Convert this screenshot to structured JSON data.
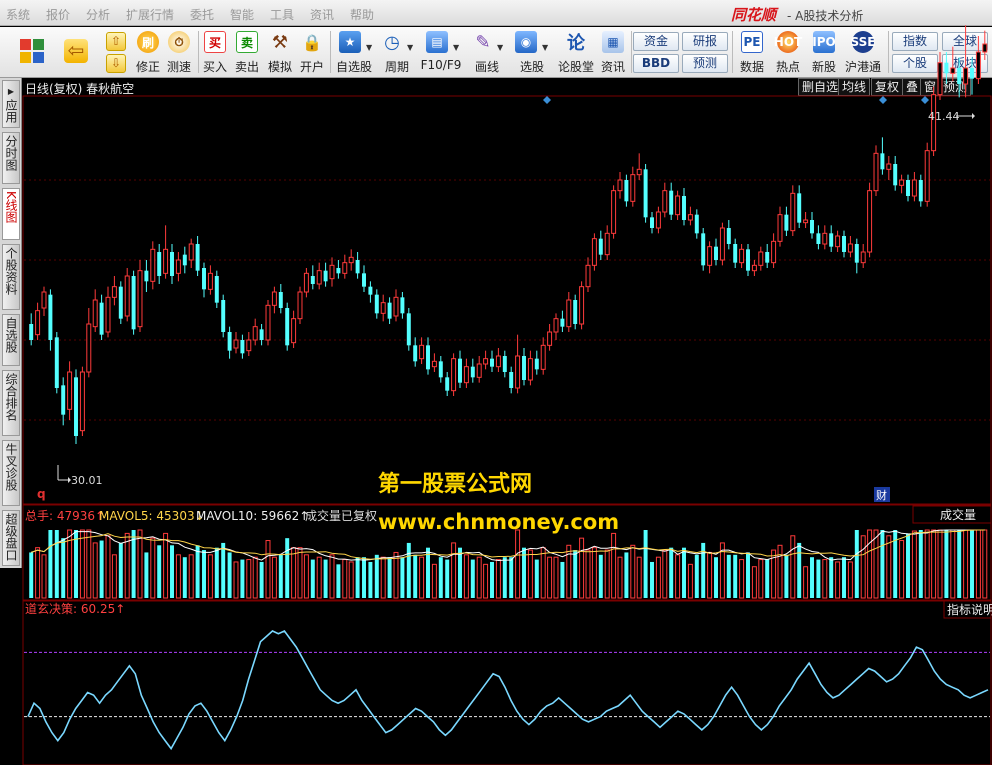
{
  "menu": [
    "系统",
    "报价",
    "分析",
    "扩展行情",
    "委托",
    "智能",
    "工具",
    "资讯",
    "帮助"
  ],
  "app": {
    "logo": "同花顺",
    "title": "- A股技术分析"
  },
  "toolbar": {
    "buttons": [
      {
        "label": "修正",
        "icon": "刷"
      },
      {
        "label": "测速",
        "icon": "⏱"
      },
      {
        "label": "买入",
        "icon": "买"
      },
      {
        "label": "卖出",
        "icon": "卖"
      },
      {
        "label": "模拟",
        "icon": "⚒"
      },
      {
        "label": "开户",
        "icon": "🔒"
      },
      {
        "label": "自选股",
        "icon": "★"
      },
      {
        "label": "周期",
        "icon": "◷"
      },
      {
        "label": "F10/F9",
        "icon": "▤"
      },
      {
        "label": "画线",
        "icon": "✎"
      },
      {
        "label": "选股",
        "icon": "◉"
      },
      {
        "label": "论股堂",
        "icon": "论"
      },
      {
        "label": "资讯",
        "icon": "▦"
      },
      {
        "label": "数据",
        "icon": "PE"
      },
      {
        "label": "热点",
        "icon": "HOT"
      },
      {
        "label": "新股",
        "icon": "IPO"
      },
      {
        "label": "沪港通",
        "icon": "SSE"
      }
    ],
    "boxes": [
      "资金",
      "BBD",
      "研报",
      "预测",
      "指数",
      "个股",
      "全球",
      "板块"
    ]
  },
  "sidetabs": [
    {
      "label": "应用",
      "active": false
    },
    {
      "label": "分时图",
      "active": false
    },
    {
      "label": "K线图",
      "active": true
    },
    {
      "label": "个股资料",
      "active": false
    },
    {
      "label": "自选股",
      "active": false
    },
    {
      "label": "综合排名",
      "active": false
    },
    {
      "label": "牛叉诊股",
      "active": false
    },
    {
      "label": "超级盘口",
      "active": false
    }
  ],
  "chart_header": {
    "title": "日线(复权) 春秋航空",
    "buttons": [
      "删自选",
      "均线",
      "复权",
      "叠",
      "窗",
      "预测"
    ]
  },
  "chart_data": {
    "type": "candlestick",
    "price_range": [
      28,
      43
    ],
    "high_label": "41.44",
    "low_label": "30.01",
    "candles": [
      [
        34.6,
        34.0,
        35.0,
        33.8
      ],
      [
        34.2,
        35.1,
        35.4,
        34.0
      ],
      [
        35.2,
        35.8,
        36.0,
        34.9
      ],
      [
        35.7,
        34.0,
        35.9,
        33.6
      ],
      [
        34.1,
        32.2,
        34.3,
        32.0
      ],
      [
        32.3,
        31.2,
        32.6,
        30.8
      ],
      [
        31.4,
        32.8,
        33.2,
        31.0
      ],
      [
        32.6,
        30.4,
        32.9,
        30.1
      ],
      [
        30.6,
        32.8,
        33.0,
        30.4
      ],
      [
        32.8,
        34.6,
        35.2,
        32.6
      ],
      [
        34.5,
        35.5,
        35.9,
        34.3
      ],
      [
        35.4,
        34.2,
        35.7,
        34.0
      ],
      [
        34.3,
        35.6,
        36.0,
        34.1
      ],
      [
        35.6,
        36.0,
        36.4,
        35.3
      ],
      [
        36.0,
        34.8,
        36.2,
        34.6
      ],
      [
        34.9,
        36.4,
        36.7,
        34.7
      ],
      [
        36.4,
        34.4,
        36.6,
        34.2
      ],
      [
        34.5,
        36.6,
        37.0,
        34.3
      ],
      [
        36.6,
        36.2,
        37.0,
        35.8
      ],
      [
        36.2,
        37.4,
        37.7,
        35.9
      ],
      [
        37.3,
        36.4,
        37.6,
        36.1
      ],
      [
        36.5,
        37.4,
        38.3,
        36.3
      ],
      [
        37.3,
        36.4,
        37.6,
        36.1
      ],
      [
        36.5,
        37.0,
        37.3,
        36.2
      ],
      [
        37.2,
        36.8,
        37.5,
        36.5
      ],
      [
        37.0,
        37.6,
        37.8,
        36.7
      ],
      [
        37.6,
        36.6,
        37.9,
        36.4
      ],
      [
        36.7,
        35.9,
        36.9,
        35.6
      ],
      [
        35.9,
        36.5,
        36.8,
        35.7
      ],
      [
        36.4,
        35.4,
        36.6,
        35.2
      ],
      [
        35.5,
        34.3,
        35.7,
        34.1
      ],
      [
        34.3,
        33.6,
        34.5,
        33.3
      ],
      [
        33.7,
        34.0,
        34.3,
        33.5
      ],
      [
        34.0,
        33.5,
        34.2,
        33.3
      ],
      [
        33.6,
        34.0,
        34.3,
        33.4
      ],
      [
        34.0,
        34.5,
        34.8,
        33.8
      ],
      [
        34.4,
        34.0,
        34.6,
        33.8
      ],
      [
        34.0,
        35.3,
        35.5,
        33.8
      ],
      [
        35.3,
        35.8,
        36.0,
        35.0
      ],
      [
        35.8,
        35.2,
        36.1,
        35.0
      ],
      [
        35.2,
        33.8,
        35.4,
        33.6
      ],
      [
        33.9,
        34.8,
        35.1,
        33.7
      ],
      [
        34.8,
        35.8,
        36.0,
        34.6
      ],
      [
        35.8,
        36.5,
        36.7,
        35.6
      ],
      [
        36.4,
        36.1,
        36.8,
        35.9
      ],
      [
        36.1,
        36.6,
        36.9,
        35.9
      ],
      [
        36.6,
        36.2,
        36.9,
        36.0
      ],
      [
        36.3,
        36.8,
        37.1,
        36.0
      ],
      [
        36.7,
        36.5,
        37.0,
        36.3
      ],
      [
        36.5,
        36.9,
        37.2,
        36.3
      ],
      [
        36.9,
        37.1,
        37.4,
        36.6
      ],
      [
        37.0,
        36.5,
        37.3,
        36.3
      ],
      [
        36.5,
        36.0,
        36.8,
        35.8
      ],
      [
        36.0,
        35.7,
        36.2,
        35.4
      ],
      [
        35.7,
        35.0,
        35.9,
        34.8
      ],
      [
        35.0,
        35.4,
        35.7,
        34.7
      ],
      [
        35.4,
        34.8,
        35.6,
        34.6
      ],
      [
        34.9,
        35.6,
        35.9,
        34.7
      ],
      [
        35.6,
        35.0,
        35.8,
        34.8
      ],
      [
        35.0,
        33.8,
        35.2,
        33.6
      ],
      [
        33.8,
        33.2,
        34.1,
        33.0
      ],
      [
        33.3,
        33.8,
        34.1,
        33.1
      ],
      [
        33.8,
        32.9,
        34.1,
        32.7
      ],
      [
        33.0,
        33.2,
        33.5,
        32.8
      ],
      [
        33.2,
        32.6,
        33.4,
        32.4
      ],
      [
        32.6,
        32.1,
        32.8,
        31.9
      ],
      [
        32.1,
        33.3,
        33.5,
        31.9
      ],
      [
        33.3,
        32.4,
        33.6,
        32.2
      ],
      [
        32.4,
        33.0,
        33.3,
        32.2
      ],
      [
        33.0,
        32.6,
        33.3,
        32.4
      ],
      [
        32.6,
        33.1,
        33.4,
        32.4
      ],
      [
        33.1,
        33.3,
        33.6,
        32.9
      ],
      [
        33.3,
        33.0,
        33.6,
        32.8
      ],
      [
        33.0,
        33.4,
        33.7,
        32.8
      ],
      [
        33.4,
        32.8,
        33.6,
        32.6
      ],
      [
        32.8,
        32.2,
        33.0,
        32.0
      ],
      [
        32.2,
        33.4,
        34.2,
        32.0
      ],
      [
        33.4,
        32.5,
        33.7,
        32.3
      ],
      [
        32.5,
        33.3,
        33.6,
        32.3
      ],
      [
        33.3,
        32.9,
        33.6,
        32.7
      ],
      [
        32.9,
        33.8,
        34.1,
        32.7
      ],
      [
        33.8,
        34.3,
        34.6,
        33.6
      ],
      [
        34.3,
        34.8,
        35.0,
        34.0
      ],
      [
        34.8,
        34.5,
        35.1,
        34.3
      ],
      [
        34.5,
        35.5,
        35.8,
        34.3
      ],
      [
        35.5,
        34.6,
        35.7,
        34.4
      ],
      [
        34.6,
        36.0,
        36.2,
        34.4
      ],
      [
        36.0,
        36.8,
        37.1,
        35.8
      ],
      [
        36.8,
        37.8,
        38.0,
        36.6
      ],
      [
        37.8,
        37.2,
        38.1,
        37.0
      ],
      [
        37.2,
        38.0,
        38.3,
        37.0
      ],
      [
        38.0,
        39.6,
        39.8,
        37.8
      ],
      [
        39.6,
        40.0,
        40.3,
        39.3
      ],
      [
        40.0,
        39.2,
        40.2,
        39.0
      ],
      [
        39.2,
        40.2,
        40.5,
        39.0
      ],
      [
        40.2,
        40.4,
        41.0,
        40.0
      ],
      [
        40.4,
        38.6,
        40.6,
        38.4
      ],
      [
        38.6,
        38.2,
        38.8,
        38.0
      ],
      [
        38.2,
        38.8,
        39.0,
        38.0
      ],
      [
        38.8,
        39.6,
        39.9,
        38.6
      ],
      [
        39.6,
        38.7,
        39.9,
        38.5
      ],
      [
        38.7,
        39.4,
        39.6,
        38.5
      ],
      [
        39.4,
        38.5,
        39.7,
        38.3
      ],
      [
        38.5,
        38.7,
        39.0,
        38.3
      ],
      [
        38.7,
        38.0,
        38.9,
        37.8
      ],
      [
        38.0,
        36.8,
        38.2,
        36.6
      ],
      [
        36.8,
        37.5,
        37.7,
        36.5
      ],
      [
        37.5,
        37.0,
        37.8,
        36.8
      ],
      [
        37.0,
        38.2,
        38.4,
        36.8
      ],
      [
        38.2,
        37.6,
        38.5,
        37.4
      ],
      [
        37.6,
        36.9,
        37.8,
        36.7
      ],
      [
        36.9,
        37.4,
        37.6,
        36.7
      ],
      [
        37.4,
        36.6,
        37.6,
        36.4
      ],
      [
        36.6,
        36.8,
        37.0,
        36.4
      ],
      [
        36.8,
        37.3,
        37.5,
        36.6
      ],
      [
        37.3,
        36.9,
        37.6,
        36.7
      ],
      [
        36.9,
        37.7,
        38.0,
        36.7
      ],
      [
        37.7,
        38.7,
        39.0,
        37.5
      ],
      [
        38.7,
        38.1,
        39.0,
        37.9
      ],
      [
        38.1,
        39.5,
        39.8,
        37.9
      ],
      [
        39.5,
        38.4,
        39.8,
        38.2
      ],
      [
        38.4,
        38.5,
        38.8,
        38.2
      ],
      [
        38.5,
        38.0,
        38.8,
        37.8
      ],
      [
        38.0,
        37.6,
        38.3,
        37.4
      ],
      [
        37.6,
        38.0,
        38.3,
        37.4
      ],
      [
        38.0,
        37.5,
        38.3,
        37.3
      ],
      [
        37.5,
        37.9,
        38.1,
        37.3
      ],
      [
        37.9,
        37.3,
        38.1,
        37.1
      ],
      [
        37.3,
        37.6,
        37.9,
        37.1
      ],
      [
        37.6,
        36.9,
        37.8,
        36.5
      ],
      [
        36.9,
        37.3,
        37.6,
        36.7
      ],
      [
        37.3,
        39.6,
        39.9,
        37.1
      ],
      [
        39.6,
        41.0,
        41.3,
        39.4
      ],
      [
        41.0,
        40.4,
        41.6,
        40.2
      ],
      [
        40.4,
        40.6,
        40.9,
        40.0
      ],
      [
        40.6,
        39.8,
        40.9,
        39.6
      ],
      [
        39.8,
        40.0,
        40.2,
        39.5
      ],
      [
        40.0,
        39.4,
        40.2,
        39.2
      ],
      [
        39.4,
        40.0,
        40.3,
        39.2
      ],
      [
        40.0,
        39.2,
        40.2,
        39.0
      ],
      [
        39.2,
        41.1,
        41.4,
        39.0
      ],
      [
        41.1,
        43.2,
        43.5,
        40.9
      ],
      [
        43.2,
        44.4,
        44.8,
        43.0
      ],
      [
        44.4,
        44.0,
        44.8,
        43.6
      ],
      [
        44.0,
        44.2,
        45.0,
        43.7
      ],
      [
        44.2,
        43.6,
        44.6,
        43.1
      ],
      [
        43.6,
        44.2,
        45.8,
        43.1
      ],
      [
        44.2,
        43.8,
        44.6,
        43.2
      ],
      [
        43.8,
        44.8,
        45.4,
        43.6
      ],
      [
        44.8,
        45.1,
        45.6,
        44.5
      ]
    ],
    "volume_panel": {
      "label_total": "总手: 47936↑",
      "label_ma5": "MAVOL5: 45303↓",
      "label_ma10": "MAVOL10: 59662↑",
      "note": "成交量已复权",
      "button": "成交量"
    },
    "indicator_panel": {
      "label": "道玄决策: 60.25↑",
      "button": "指标说明",
      "values": [
        52,
        57,
        55,
        50,
        46,
        43,
        46,
        51,
        55,
        58,
        61,
        60,
        57,
        60,
        62,
        65,
        68,
        71,
        68,
        60,
        55,
        50,
        46,
        43,
        40,
        44,
        48,
        53,
        56,
        57,
        54,
        50,
        46,
        43,
        47,
        52,
        58,
        66,
        73,
        80,
        82,
        84,
        83,
        84,
        81,
        78,
        74,
        70,
        66,
        62,
        60,
        58,
        57,
        58,
        60,
        62,
        58,
        55,
        52,
        49,
        46,
        47,
        49,
        51,
        53,
        55,
        54,
        52,
        50,
        47,
        45,
        47,
        50,
        53,
        56,
        59,
        62,
        65,
        68,
        67,
        63,
        58,
        54,
        51,
        49,
        51,
        54,
        56,
        57,
        59,
        57,
        55,
        53,
        51,
        50,
        51,
        52,
        54,
        55,
        56,
        58,
        60,
        57,
        54,
        52,
        50,
        48,
        50,
        52,
        54,
        53,
        51,
        49,
        47,
        49,
        52,
        56,
        60,
        63,
        60,
        56,
        52,
        49,
        47,
        49,
        52,
        56,
        59,
        62,
        66,
        69,
        72,
        68,
        64,
        61,
        59,
        60,
        62,
        64,
        66,
        68,
        70,
        69,
        67,
        65,
        66,
        68,
        71,
        74,
        78,
        77,
        73,
        69,
        66,
        64,
        63,
        62,
        60,
        59,
        60,
        61,
        62
      ],
      "ref_high": 76,
      "ref_low": 52
    }
  },
  "watermark": {
    "line1": "第一股票公式网",
    "line2": "www.chnmoney.com"
  },
  "marks": {
    "q": "q",
    "cai": "财"
  }
}
